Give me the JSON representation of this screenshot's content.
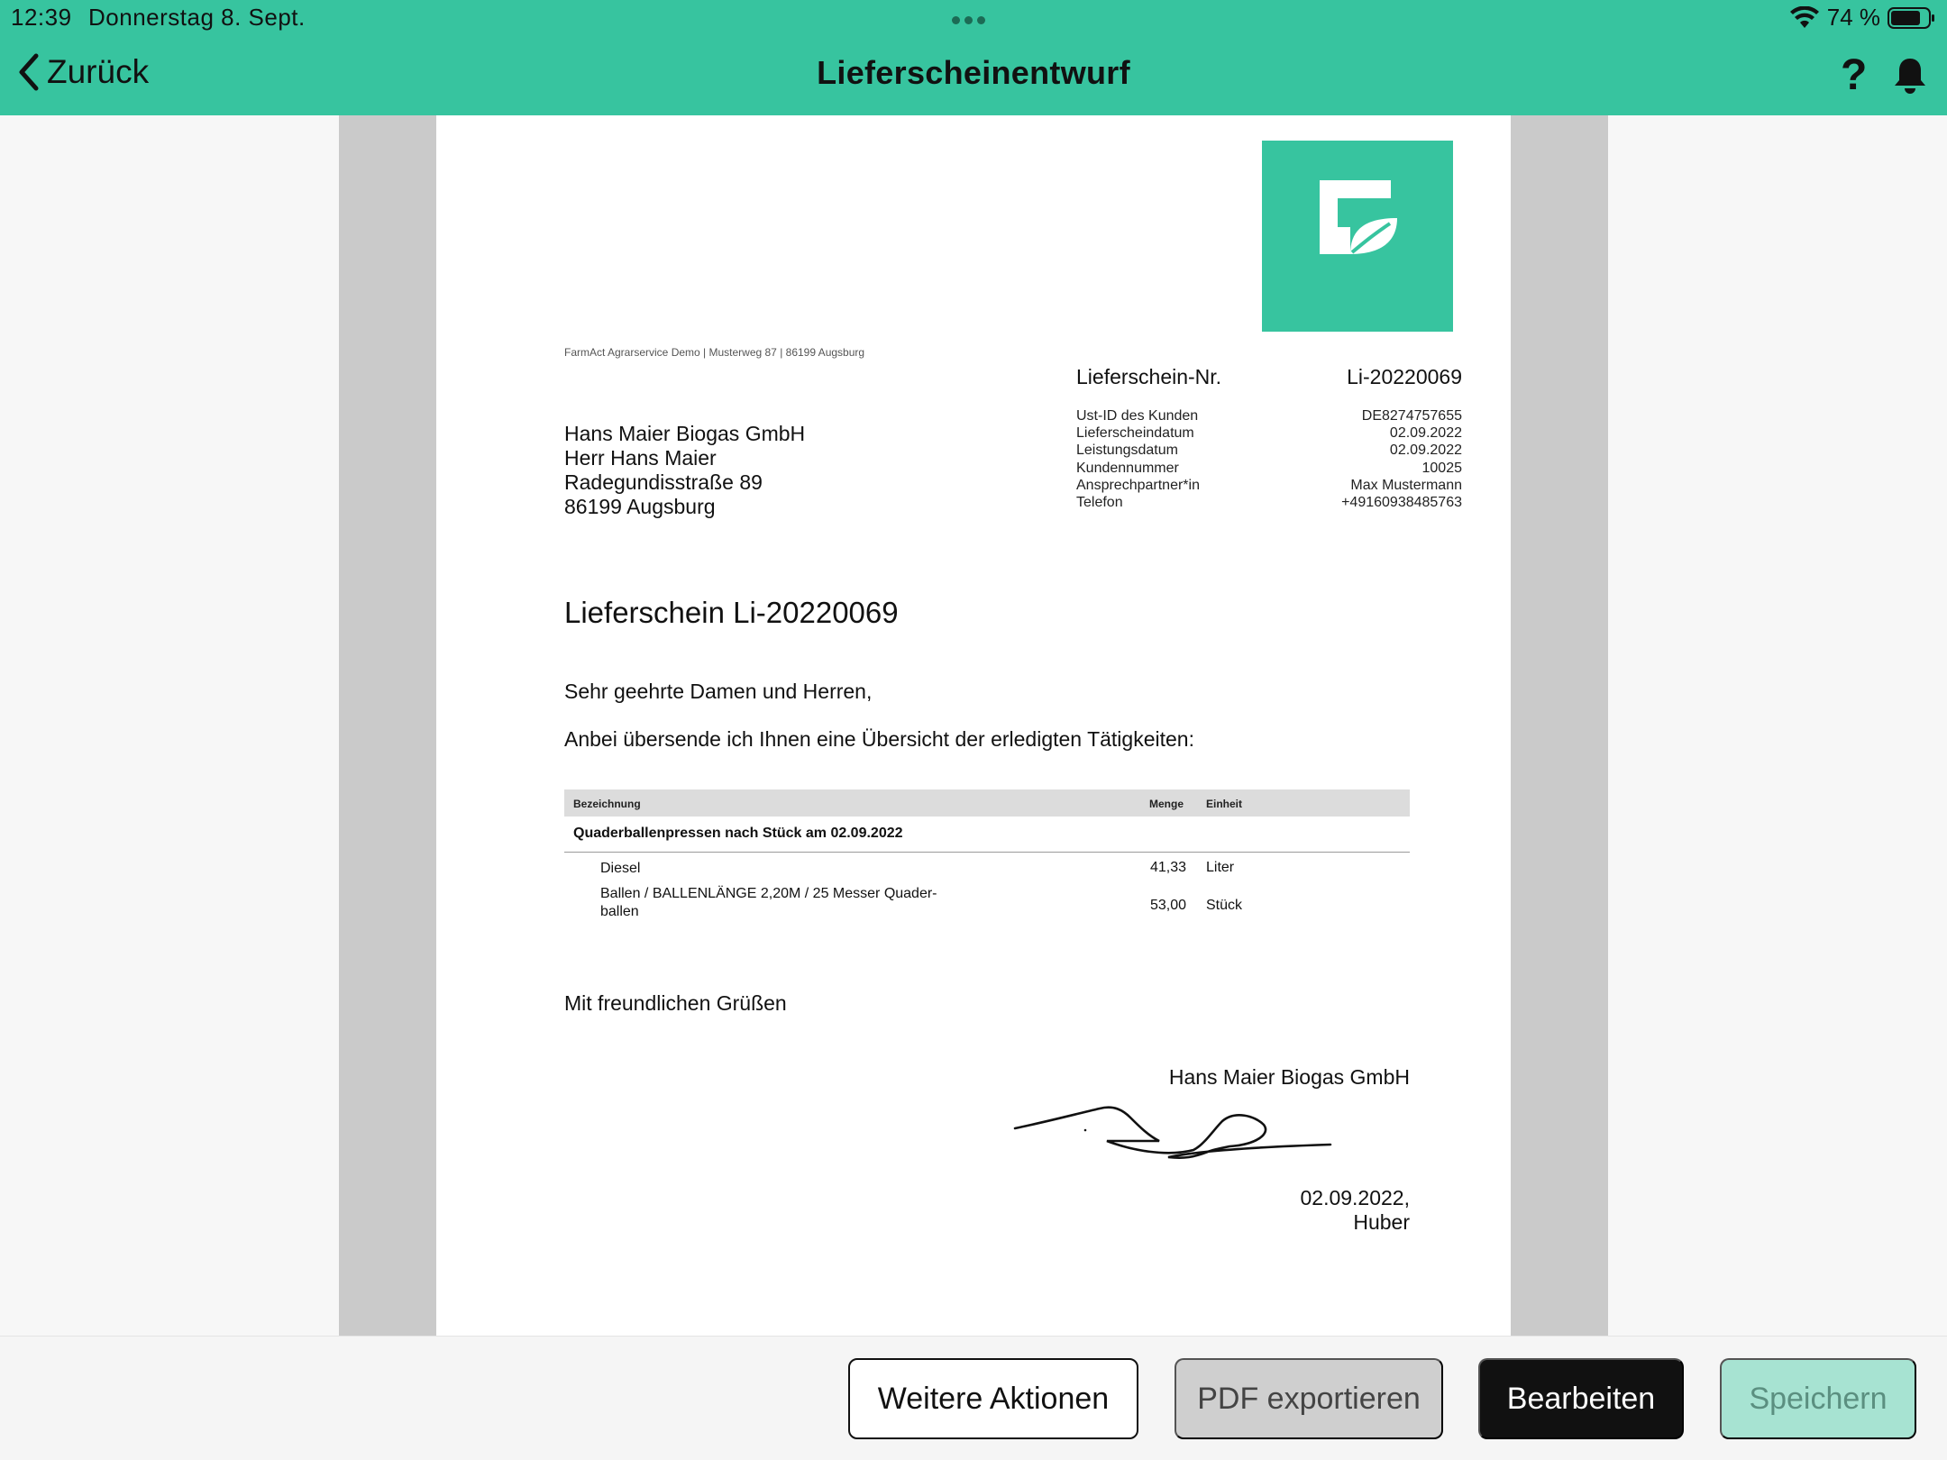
{
  "status_bar": {
    "time": "12:39",
    "date": "Donnerstag 8. Sept.",
    "battery": "74 %"
  },
  "nav": {
    "back_label": "Zurück",
    "title": "Lieferscheinentwurf",
    "help_label": "?"
  },
  "colors": {
    "brand": "#37c49f",
    "save_disabled": "#a7e3d2",
    "edit_button": "#111111"
  },
  "document": {
    "sender_line": "FarmAct Agrarservice Demo | Musterweg 87 | 86199 Augsburg",
    "recipient": {
      "line1": "Hans Maier Biogas GmbH",
      "line2": "Herr Hans Maier",
      "line3": "Radegundisstraße 89",
      "line4": "86199 Augsburg"
    },
    "meta_head": {
      "label": "Lieferschein-Nr.",
      "value": "Li-20220069"
    },
    "meta": [
      {
        "label": "Ust-ID des Kunden",
        "value": "DE8274757655"
      },
      {
        "label": "Lieferscheindatum",
        "value": "02.09.2022"
      },
      {
        "label": "Leistungsdatum",
        "value": "02.09.2022"
      },
      {
        "label": "Kundennummer",
        "value": "10025"
      },
      {
        "label": "Ansprechpartner*in",
        "value": "Max Mustermann"
      },
      {
        "label": "Telefon",
        "value": "+49160938485763"
      }
    ],
    "title": "Lieferschein Li-20220069",
    "salutation": "Sehr geehrte Damen und Herren,",
    "intro": "Anbei übersende ich Ihnen eine Übersicht der erledigten Tätigkeiten:",
    "table": {
      "headers": {
        "description": "Bezeichnung",
        "quantity": "Menge",
        "unit": "Einheit"
      },
      "group": "Quaderballenpressen nach Stück am 02.09.2022",
      "rows": [
        {
          "description": "Diesel",
          "quantity": "41,33",
          "unit": "Liter"
        },
        {
          "description_line1": "Ballen / BALLENLÄNGE 2,20M / 25 Messer  Quader-",
          "description_line2": "ballen",
          "quantity": "53,00",
          "unit": "Stück"
        }
      ]
    },
    "closing": "Mit freundlichen Grüßen",
    "signature_company": "Hans Maier Biogas GmbH",
    "signature_date": "02.09.2022,",
    "signature_name": "Huber"
  },
  "toolbar": {
    "more_label": "Weitere Aktionen",
    "pdf_label": "PDF exportieren",
    "edit_label": "Bearbeiten",
    "save_label": "Speichern"
  }
}
